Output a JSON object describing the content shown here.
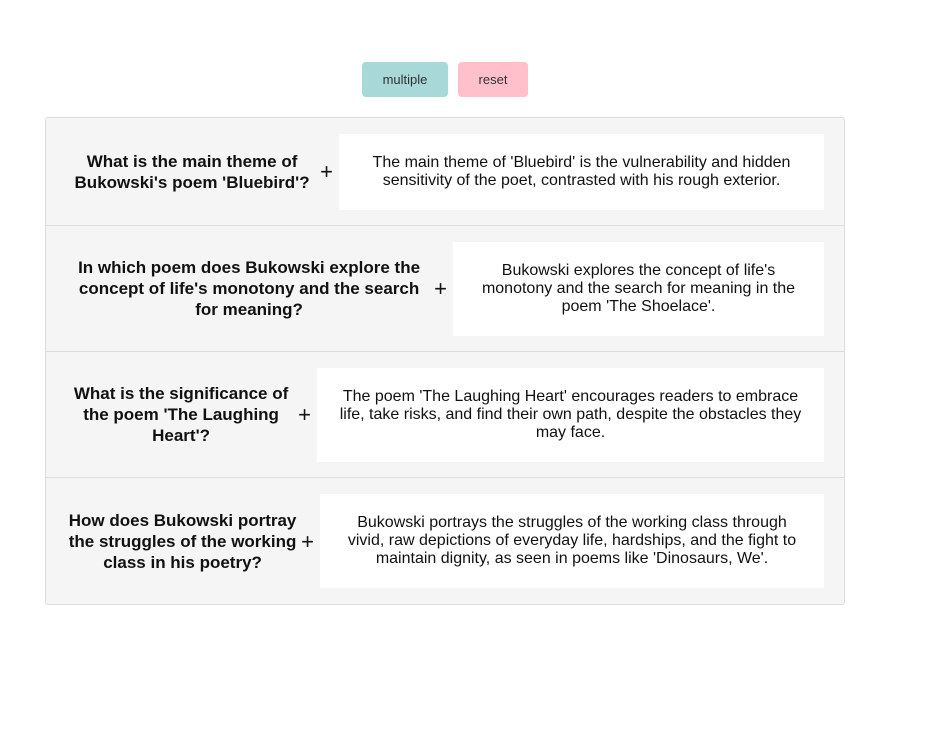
{
  "controls": {
    "multiple_label": "multiple",
    "reset_label": "reset",
    "multiple_color": "#a8d8d8",
    "reset_color": "#ffc0cb"
  },
  "accordion": {
    "expand_symbol": "+",
    "items": [
      {
        "question": "What is the main theme of Bukowski's poem 'Bluebird'?",
        "answer": "The main theme of 'Bluebird' is the vulnerability and hidden sensitivity of the poet, contrasted with his rough exterior."
      },
      {
        "question": "In which poem does Bukowski explore the concept of life's monotony and the search for meaning?",
        "answer": "Bukowski explores the concept of life's monotony and the search for meaning in the poem 'The Shoelace'."
      },
      {
        "question": "What is the significance of the poem 'The Laughing Heart'?",
        "answer": "The poem 'The Laughing Heart' encourages readers to embrace life, take risks, and find their own path, despite the obstacles they may face."
      },
      {
        "question": "How does Bukowski portray the struggles of the working class in his poetry?",
        "answer": "Bukowski portrays the struggles of the working class through vivid, raw depictions of everyday life, hardships, and the fight to maintain dignity, as seen in poems like 'Dinosaurs, We'."
      }
    ]
  }
}
